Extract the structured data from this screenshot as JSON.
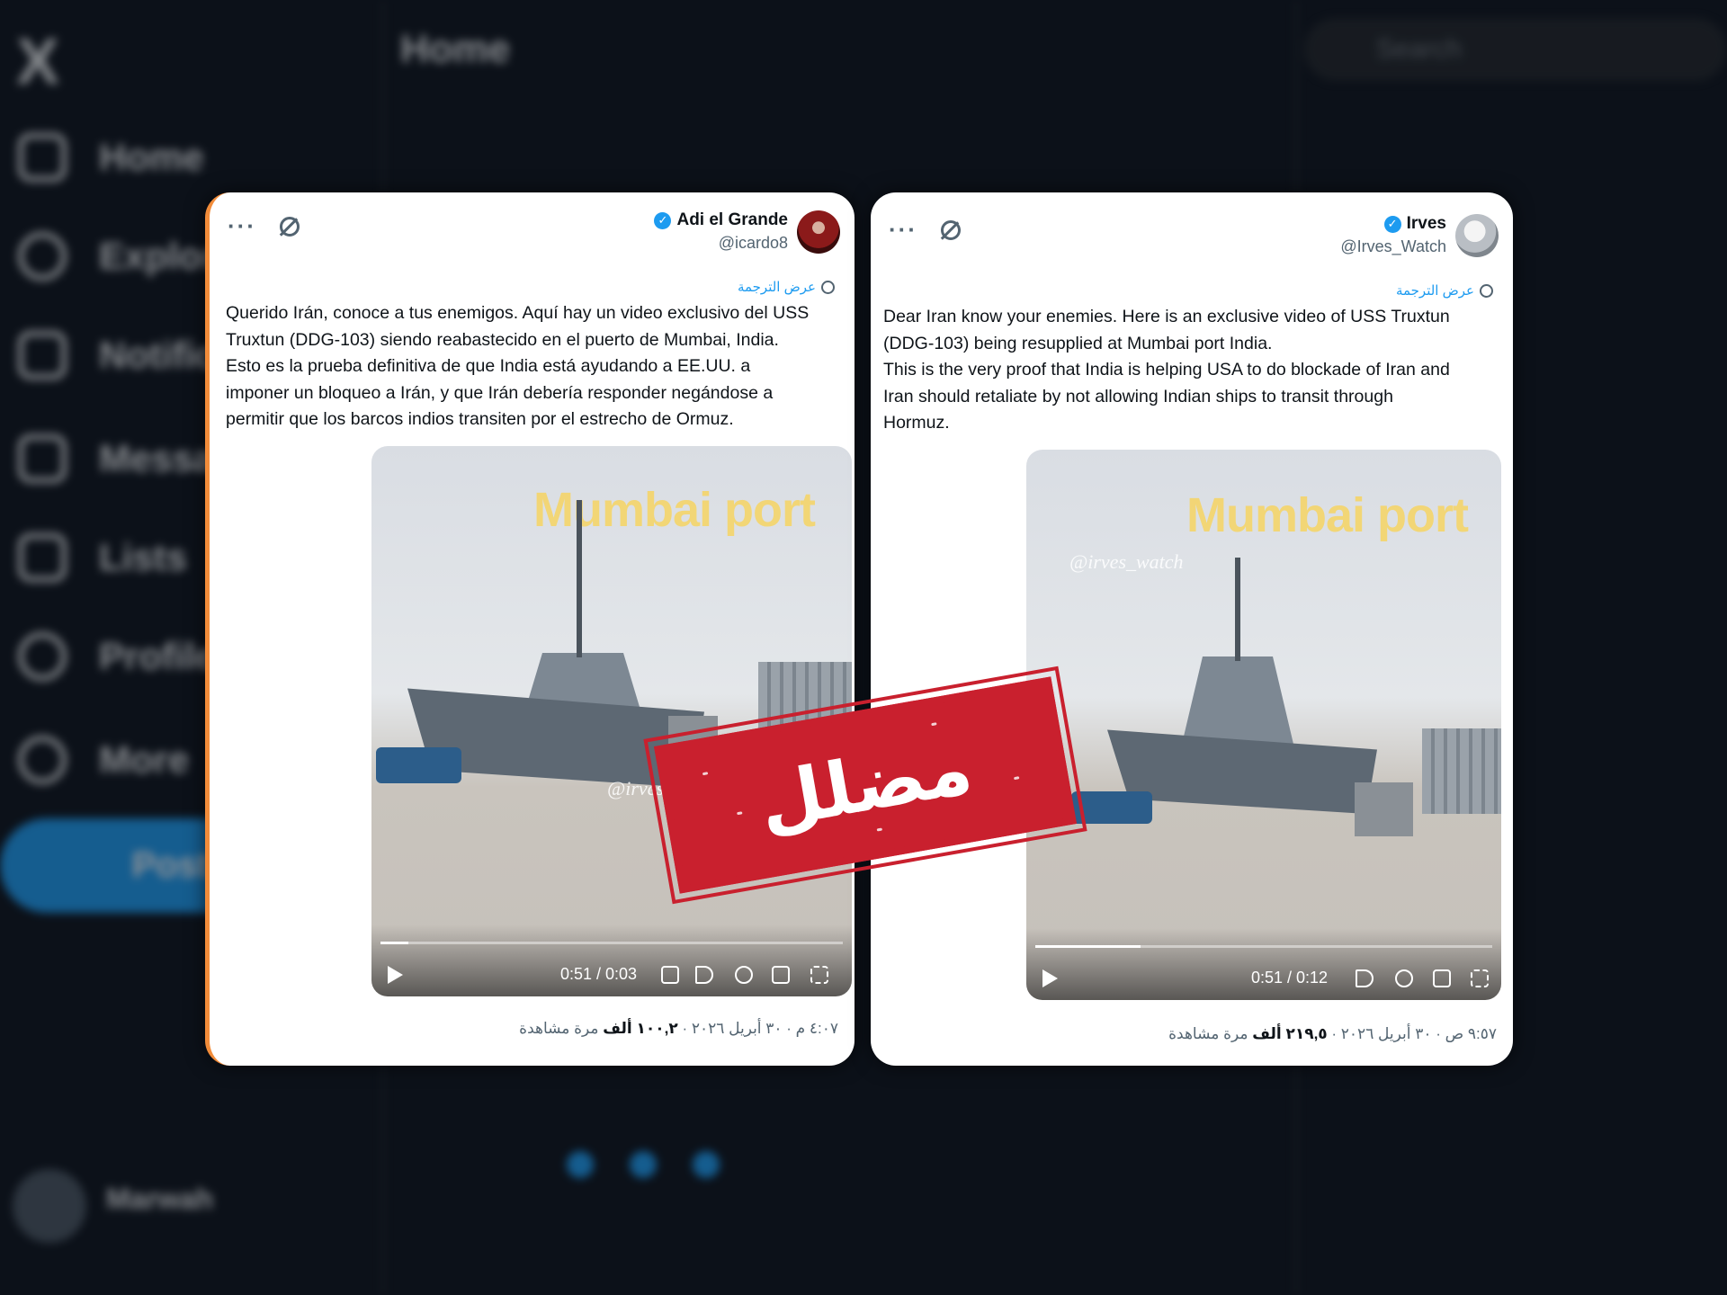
{
  "background": {
    "x_logo": "X",
    "nav": [
      "Home",
      "Explore",
      "Notifications",
      "Messages",
      "Lists",
      "Profile",
      "More"
    ],
    "post_button": "Post",
    "page_title": "Home",
    "search_placeholder": "Search",
    "account_name": "Marwah"
  },
  "cards": [
    {
      "display_name": "Adi el Grande",
      "handle": "@icardo8",
      "translate_label": "عرض الترجمة",
      "text": "Querido Irán, conoce a tus enemigos. Aquí hay un video exclusivo del USS\nTruxtun (DDG-103) siendo reabastecido en el puerto de Mumbai, India.\nEsto es la prueba definitiva de que India está ayudando a EE.UU. a\nimponer un bloqueo a Irán, y que Irán debería responder negándose a\npermitir que los barcos indios transiten por el estrecho de Ormuz.",
      "video_label": "Mumbai port",
      "video_watermark": "@irves",
      "video_time": "0:51 / 0:03",
      "progress": 0.06,
      "time": "٤:٠٧ م · ٣٠ أبريل ٢٠٢٦ ·",
      "views_count": "١٠٠,٢ ألف",
      "views_label": "مرة مشاهدة"
    },
    {
      "display_name": "Irves",
      "handle": "@Irves_Watch",
      "translate_label": "عرض الترجمة",
      "text": "Dear Iran know your enemies. Here is an exclusive video of USS Truxtun\n(DDG-103) being resupplied at Mumbai port India.\nThis is the very proof that India is helping USA to do blockade of Iran and\nIran should retaliate by not allowing Indian ships to transit through\nHormuz.",
      "video_label": "Mumbai port",
      "video_watermark": "@irves_watch",
      "video_time": "0:51 / 0:12",
      "progress": 0.23,
      "time": "٩:٥٧ ص · ٣٠ أبريل ٢٠٢٦ ·",
      "views_count": "٢١٩,٥ ألف",
      "views_label": "مرة مشاهدة"
    }
  ],
  "stamp": {
    "label": "مضلل",
    "color": "#c9202e"
  },
  "colors": {
    "accent": "#1d9bf0",
    "verified": "#1d9bf0",
    "text": "#0f1419",
    "muted": "#536471"
  }
}
